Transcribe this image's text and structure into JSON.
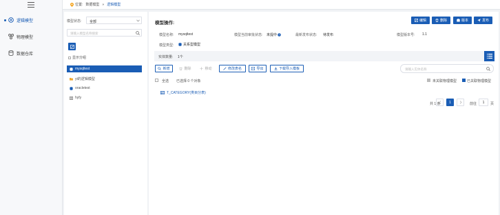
{
  "nav": {
    "items": [
      {
        "label": "逻辑模型",
        "icon": "logic-model-icon",
        "active": true
      },
      {
        "label": "物理模型",
        "icon": "physical-model-icon",
        "active": false
      },
      {
        "label": "数据仓库",
        "icon": "database-icon",
        "active": false
      }
    ]
  },
  "breadcrumb": {
    "location_label": "位置:",
    "items": [
      "数据模型",
      "逻辑模型"
    ]
  },
  "tree": {
    "status_label": "模型状态:",
    "status_value": "全部",
    "search_placeholder": "请输入模型名称搜索",
    "show_category_label": "显示分组",
    "items": [
      {
        "label": "mysqltest",
        "icon": "database-icon",
        "selected": true
      },
      {
        "label": "yt的逻辑模型",
        "icon": "folder-icon",
        "selected": false
      },
      {
        "label": "oracletest",
        "icon": "database-icon",
        "selected": false
      },
      {
        "label": "hyfy",
        "icon": "table-icon",
        "selected": false
      }
    ]
  },
  "main": {
    "title": "模型操作:",
    "header_buttons": [
      {
        "label": "编辑",
        "icon": "edit-icon"
      },
      {
        "label": "删除",
        "icon": "trash-icon"
      },
      {
        "label": "版本",
        "icon": "version-icon"
      },
      {
        "label": "发布",
        "icon": "send-icon"
      }
    ],
    "info": {
      "name_label": "模型名称:",
      "name_value": "mysqltest",
      "approval_label": "模型当前审批状态:",
      "approval_value": "未提中",
      "publish_label": "最新发布状态:",
      "publish_value": "待发布",
      "version_label": "模型版本号:",
      "version_value": "1.1",
      "type_label": "模型类型:",
      "type_value": "关系型模型"
    },
    "entity_count_label": "实体数量:",
    "entity_count_value": "1个",
    "toolbar": {
      "add": "新增",
      "delete": "删除",
      "move": "移动",
      "batch_edit": "修改表名",
      "export": "导出",
      "download_template": "下载导入模板",
      "search_placeholder": "请输入实体名称"
    },
    "select_all_label": "全选",
    "selected_count_label": "已选择 0 个对象",
    "legend": [
      {
        "label": "未关联物理模型",
        "color": "#bbbbbb"
      },
      {
        "label": "已关联物理模型",
        "color": "#1a5db5"
      }
    ],
    "entity_row": "T_CATEGORY(类目分表)",
    "pagination": {
      "total_label": "共 1 条",
      "current_page": "1",
      "goto_label": "前往",
      "goto_value": "1",
      "page_suffix": "页"
    }
  },
  "colors": {
    "accent": "#1a5db5",
    "background": "#f0f2f5"
  }
}
